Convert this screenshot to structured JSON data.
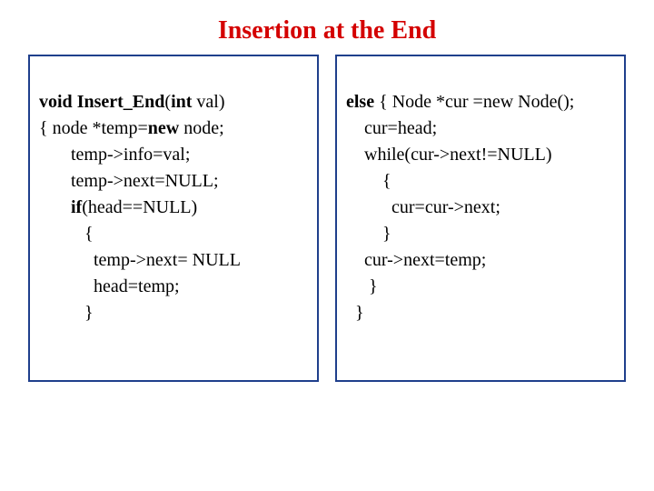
{
  "title": "Insertion at the End",
  "left": {
    "l1a": "void",
    "l1b": " Insert_End",
    "l1c": "(",
    "l1d": "int",
    "l1e": " val)",
    "l2a": "{ node *temp=",
    "l2b": "new",
    "l2c": " node;",
    "l3": "       temp->info=val;",
    "l4": "       temp->next=NULL;",
    "l5a": "       ",
    "l5b": "if",
    "l5c": "(head==NULL)",
    "l6": "          {",
    "l7": "            temp->next= NULL",
    "l8": "            head=temp;",
    "l9": "          }"
  },
  "right": {
    "l1a": "else",
    "l1b": " { Node *cur =new Node();",
    "l2": "    cur=head;",
    "l3": "    while(cur->next!=NULL)",
    "l4": "        {",
    "l5": "          cur=cur->next;",
    "l6": "        }",
    "l7": "    cur->next=temp;",
    "l8": "     }",
    "l9": "  }"
  }
}
